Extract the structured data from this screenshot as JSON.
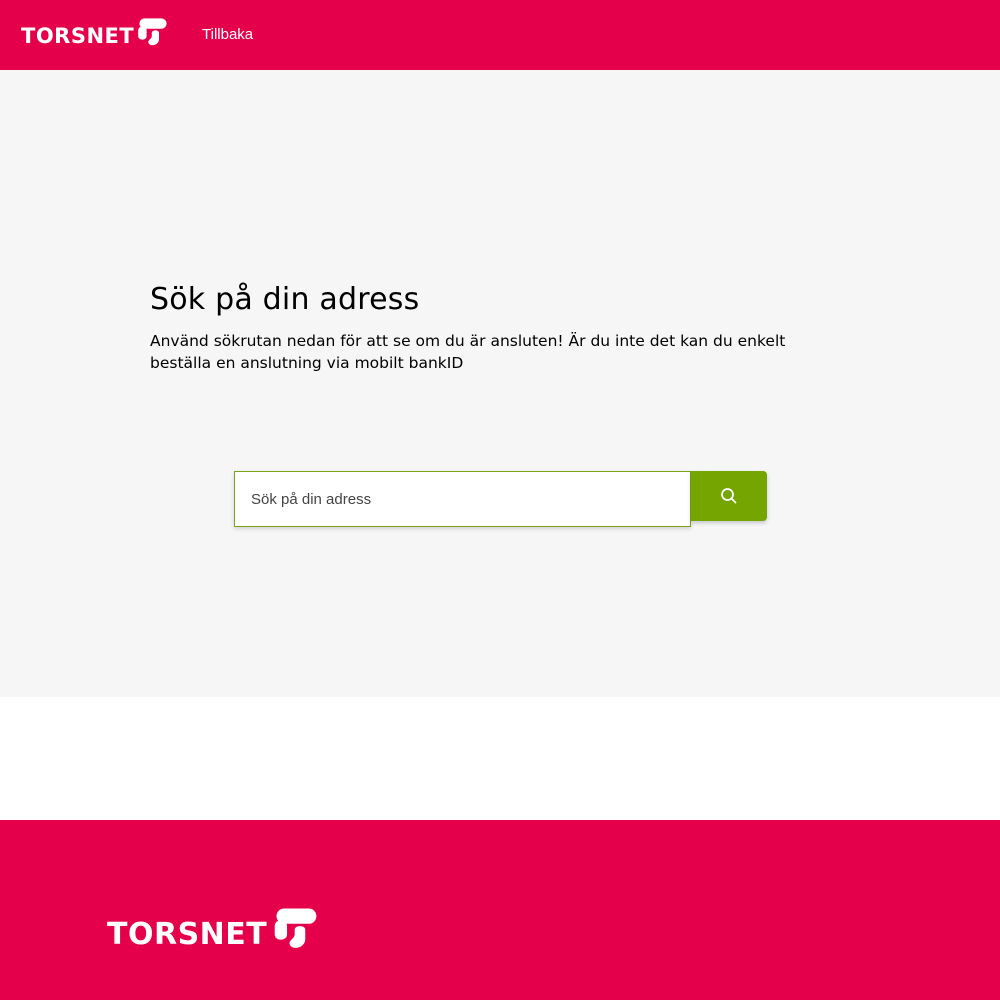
{
  "header": {
    "logo": {
      "text": "TORSNET",
      "icon": "torsnet-logo-mark"
    },
    "back_link": "Tillbaka"
  },
  "hero": {
    "title": "Sök på din adress",
    "description": "Använd sökrutan nedan för att se om du är ansluten! Är du inte det kan du enkelt beställa en anslutning via mobilt bankID"
  },
  "search": {
    "placeholder": "Sök på din adress",
    "value": "",
    "button_icon": "search-icon"
  },
  "footer": {
    "logo": {
      "text": "TORSNET",
      "icon": "torsnet-logo-mark"
    }
  },
  "colors": {
    "brand": "#e4004a",
    "accent": "#74a500",
    "hero_background": "#f6f6f6"
  }
}
